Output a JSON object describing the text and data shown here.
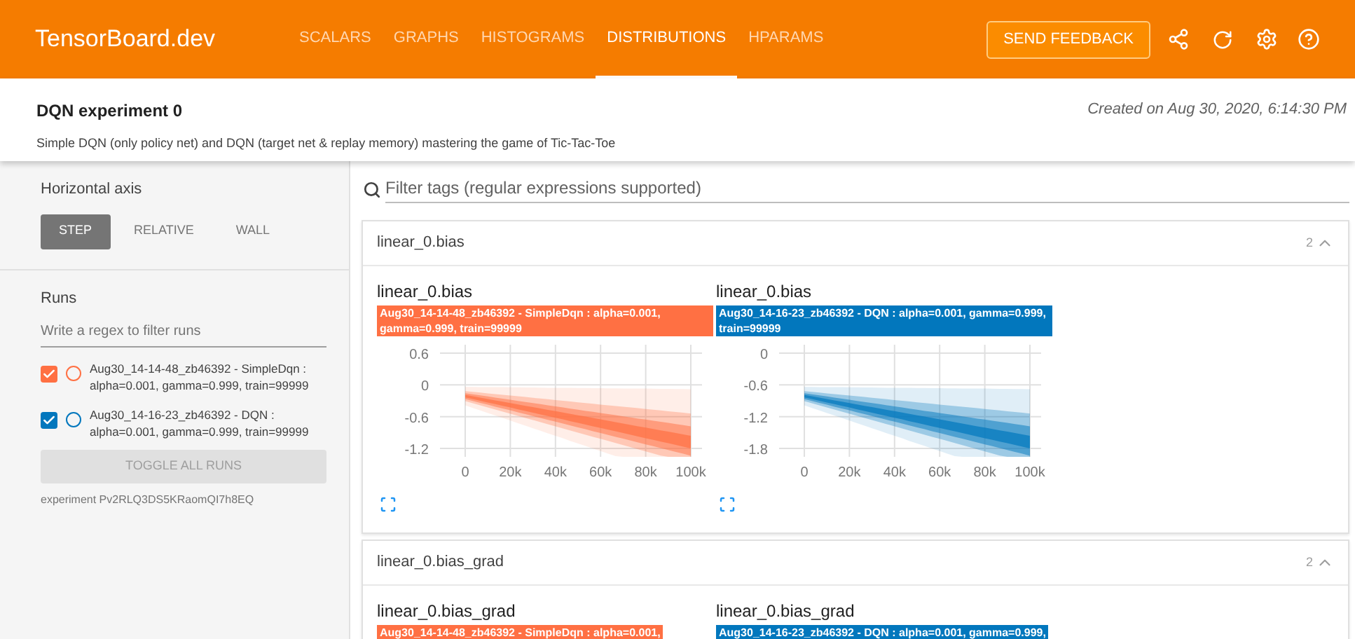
{
  "header": {
    "brand": "TensorBoard.dev",
    "tabs": [
      {
        "label": "SCALARS",
        "selected": false
      },
      {
        "label": "GRAPHS",
        "selected": false
      },
      {
        "label": "HISTOGRAMS",
        "selected": false
      },
      {
        "label": "DISTRIBUTIONS",
        "selected": true
      },
      {
        "label": "HPARAMS",
        "selected": false
      }
    ],
    "feedback_button": "SEND FEEDBACK"
  },
  "experiment": {
    "title": "DQN experiment 0",
    "created": "Created on Aug 30, 2020, 6:14:30 PM",
    "description": "Simple DQN (only policy net) and DQN (target net & replay memory) mastering the game of Tic-Tac-Toe"
  },
  "sidebar": {
    "axis_label": "Horizontal axis",
    "axis_options": [
      {
        "label": "STEP",
        "selected": true
      },
      {
        "label": "RELATIVE",
        "selected": false
      },
      {
        "label": "WALL",
        "selected": false
      }
    ],
    "runs_label": "Runs",
    "runs_filter": {
      "placeholder": "Write a regex to filter runs"
    },
    "runs": [
      {
        "label": "Aug30_14-14-48_zb46392 - SimpleDqn : alpha=0.001, gamma=0.999, train=99999",
        "checked": true,
        "color": "#ff7043"
      },
      {
        "label": "Aug30_14-16-23_zb46392 - DQN : alpha=0.001, gamma=0.999, train=99999",
        "checked": true,
        "color": "#0277bd"
      }
    ],
    "toggle_button": "TOGGLE ALL RUNS",
    "experiment_id": "experiment Pv2RLQ3DS5KRaomQI7h8EQ"
  },
  "filter": {
    "placeholder": "Filter tags (regular expressions supported)"
  },
  "sections": [
    {
      "title": "linear_0.bias",
      "count": "2",
      "expanded": true,
      "cards": [
        {
          "title": "linear_0.bias",
          "run": "Aug30_14-14-48_zb46392 - SimpleDqn : alpha=0.001, gamma=0.999, train=99999",
          "color": "#ff7043",
          "y_ticks": [
            "0.6",
            "0",
            "-0.6",
            "-1.2"
          ],
          "x_ticks": [
            "0",
            "20k",
            "40k",
            "60k",
            "80k",
            "100k"
          ]
        },
        {
          "title": "linear_0.bias",
          "run": "Aug30_14-16-23_zb46392 - DQN : alpha=0.001, gamma=0.999, train=99999",
          "color": "#0277bd",
          "y_ticks": [
            "0",
            "-0.6",
            "-1.2",
            "-1.8"
          ],
          "x_ticks": [
            "0",
            "20k",
            "40k",
            "60k",
            "80k",
            "100k"
          ]
        }
      ]
    },
    {
      "title": "linear_0.bias_grad",
      "count": "2",
      "expanded": true,
      "cards": [
        {
          "title": "linear_0.bias_grad",
          "run": "Aug30_14-14-48_zb46392 - SimpleDqn : alpha=0.001,",
          "color": "#ff7043"
        },
        {
          "title": "linear_0.bias_grad",
          "run": "Aug30_14-16-23_zb46392 - DQN : alpha=0.001, gamma=0.999,",
          "color": "#0277bd"
        }
      ]
    }
  ]
}
